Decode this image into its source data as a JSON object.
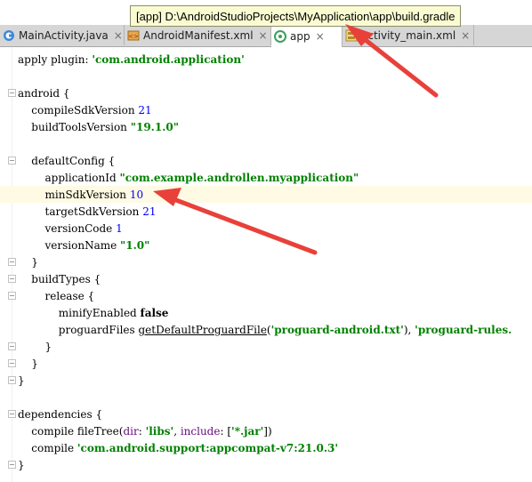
{
  "tooltip": {
    "text": "[app] D:\\AndroidStudioProjects\\MyApplication\\app\\build.gradle"
  },
  "tabs": [
    {
      "label": "MainActivity.java",
      "icon": "java-class-icon",
      "close": "×"
    },
    {
      "label": "AndroidManifest.xml",
      "icon": "xml-file-icon",
      "close": "×"
    },
    {
      "label": "app",
      "icon": "gradle-module-icon",
      "close": "×"
    },
    {
      "label": "activity_main.xml",
      "icon": "layout-file-icon",
      "close": "×"
    }
  ],
  "code": [
    "apply plugin: 'com.android.application'",
    "",
    "android {",
    "    compileSdkVersion 21",
    "    buildToolsVersion \"19.1.0\"",
    "",
    "    defaultConfig {",
    "        applicationId \"com.example.androllen.myapplication\"",
    "        minSdkVersion 10",
    "        targetSdkVersion 21",
    "        versionCode 1",
    "        versionName \"1.0\"",
    "    }",
    "    buildTypes {",
    "        release {",
    "            minifyEnabled false",
    "            proguardFiles getDefaultProguardFile('proguard-android.txt'), 'proguard-rules.",
    "        }",
    "    }",
    "}",
    "",
    "dependencies {",
    "    compile fileTree(dir: 'libs', include: ['*.jar'])",
    "    compile 'com.android.support:appcompat-v7:21.0.3'",
    "}"
  ],
  "colors": {
    "string": "#008000",
    "number": "#0000ff",
    "named_arg": "#660e7a",
    "caret_row": "#fffae3",
    "annotation_arrow": "#e8413a"
  }
}
